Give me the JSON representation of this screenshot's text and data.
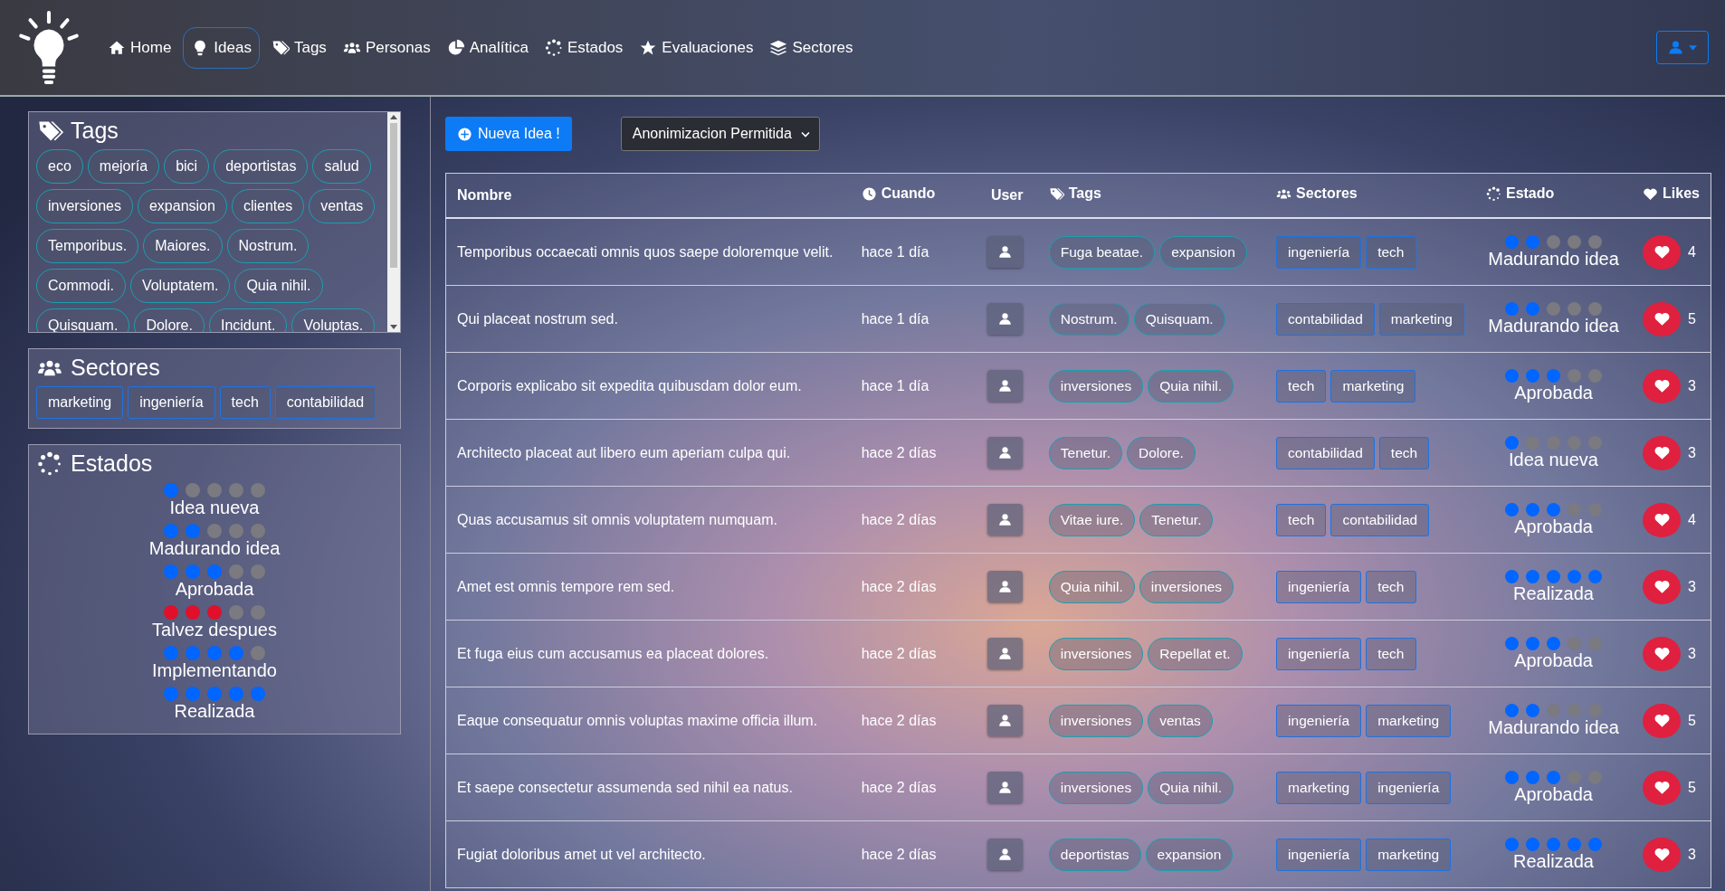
{
  "nav": {
    "items": [
      {
        "label": "Home",
        "selected": false
      },
      {
        "label": "Ideas",
        "selected": true
      },
      {
        "label": "Tags",
        "selected": false
      },
      {
        "label": "Personas",
        "selected": false
      },
      {
        "label": "Analítica",
        "selected": false
      },
      {
        "label": "Estados",
        "selected": false
      },
      {
        "label": "Evaluaciones",
        "selected": false
      },
      {
        "label": "Sectores",
        "selected": false
      }
    ]
  },
  "sidebar": {
    "tags": {
      "title": "Tags",
      "items": [
        "eco",
        "mejoría",
        "bici",
        "deportistas",
        "salud",
        "inversiones",
        "expansion",
        "clientes",
        "ventas",
        "Temporibus.",
        "Maiores.",
        "Nostrum.",
        "Commodi.",
        "Voluptatem.",
        "Quia nihil.",
        "Quisquam.",
        "Dolore.",
        "Incidunt.",
        "Voluptas."
      ]
    },
    "sectores": {
      "title": "Sectores",
      "items": [
        "marketing",
        "ingeniería",
        "tech",
        "contabilidad"
      ]
    },
    "estados": {
      "title": "Estados",
      "items": [
        {
          "label": "Idea nueva",
          "stars": 1,
          "color": "#0066ff"
        },
        {
          "label": "Madurando idea",
          "stars": 2,
          "color": "#0066ff"
        },
        {
          "label": "Aprobada",
          "stars": 3,
          "color": "#0066ff"
        },
        {
          "label": "Talvez despues",
          "stars": 3,
          "color": "#e0102a"
        },
        {
          "label": "Implementando",
          "stars": 4,
          "color": "#0066ff"
        },
        {
          "label": "Realizada",
          "stars": 5,
          "color": "#0066ff"
        }
      ]
    }
  },
  "new_button": {
    "label": "Nueva Idea !"
  },
  "filter_select": {
    "value": "Anonimizacion Permitida"
  },
  "table": {
    "columns": [
      {
        "label": "Nombre"
      },
      {
        "label": "Cuando"
      },
      {
        "label": "User"
      },
      {
        "label": "Tags"
      },
      {
        "label": "Sectores"
      },
      {
        "label": "Estado"
      },
      {
        "label": "Likes"
      }
    ],
    "rows": [
      {
        "nombre": "Temporibus occaecati omnis quos saepe doloremque velit.",
        "cuando": "hace 1 día",
        "tags": [
          "Fuga beatae.",
          "expansion"
        ],
        "sectores": [
          "ingeniería",
          "tech"
        ],
        "estado": {
          "label": "Madurando idea",
          "stars": 2
        },
        "likes": "4"
      },
      {
        "nombre": "Qui placeat nostrum sed.",
        "cuando": "hace 1 día",
        "tags": [
          "Nostrum.",
          "Quisquam."
        ],
        "sectores": [
          "contabilidad",
          "marketing"
        ],
        "estado": {
          "label": "Madurando idea",
          "stars": 2
        },
        "likes": "5"
      },
      {
        "nombre": "Corporis explicabo sit expedita quibusdam dolor eum.",
        "cuando": "hace 1 día",
        "tags": [
          "inversiones",
          "Quia nihil."
        ],
        "sectores": [
          "tech",
          "marketing"
        ],
        "estado": {
          "label": "Aprobada",
          "stars": 3
        },
        "likes": "3"
      },
      {
        "nombre": "Architecto placeat aut libero eum aperiam culpa qui.",
        "cuando": "hace 2 días",
        "tags": [
          "Tenetur.",
          "Dolore."
        ],
        "sectores": [
          "contabilidad",
          "tech"
        ],
        "estado": {
          "label": "Idea nueva",
          "stars": 1
        },
        "likes": "3"
      },
      {
        "nombre": "Quas accusamus sit omnis voluptatem numquam.",
        "cuando": "hace 2 días",
        "tags": [
          "Vitae iure.",
          "Tenetur."
        ],
        "sectores": [
          "tech",
          "contabilidad"
        ],
        "estado": {
          "label": "Aprobada",
          "stars": 3
        },
        "likes": "4"
      },
      {
        "nombre": "Amet est omnis tempore rem sed.",
        "cuando": "hace 2 días",
        "tags": [
          "Quia nihil.",
          "inversiones"
        ],
        "sectores": [
          "ingeniería",
          "tech"
        ],
        "estado": {
          "label": "Realizada",
          "stars": 5
        },
        "likes": "3"
      },
      {
        "nombre": "Et fuga eius cum accusamus ea placeat dolores.",
        "cuando": "hace 2 días",
        "tags": [
          "inversiones",
          "Repellat et."
        ],
        "sectores": [
          "ingeniería",
          "tech"
        ],
        "estado": {
          "label": "Aprobada",
          "stars": 3
        },
        "likes": "3"
      },
      {
        "nombre": "Eaque consequatur omnis voluptas maxime officia illum.",
        "cuando": "hace 2 días",
        "tags": [
          "inversiones",
          "ventas"
        ],
        "sectores": [
          "ingeniería",
          "marketing"
        ],
        "estado": {
          "label": "Madurando idea",
          "stars": 2
        },
        "likes": "5"
      },
      {
        "nombre": "Et saepe consectetur assumenda sed nihil ea natus.",
        "cuando": "hace 2 días",
        "tags": [
          "inversiones",
          "Quia nihil."
        ],
        "sectores": [
          "marketing",
          "ingeniería"
        ],
        "estado": {
          "label": "Aprobada",
          "stars": 3
        },
        "likes": "5"
      },
      {
        "nombre": "Fugiat doloribus amet ut vel architecto.",
        "cuando": "hace 2 días",
        "tags": [
          "deportistas",
          "expansion"
        ],
        "sectores": [
          "ingeniería",
          "marketing"
        ],
        "estado": {
          "label": "Realizada",
          "stars": 5
        },
        "likes": "3"
      }
    ]
  }
}
